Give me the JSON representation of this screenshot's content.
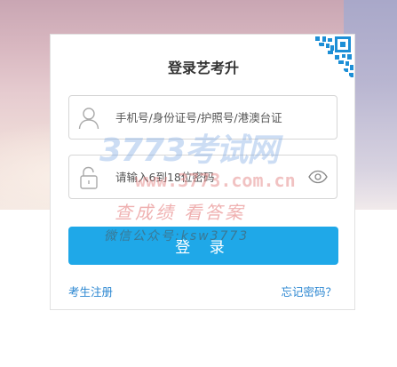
{
  "login": {
    "title": "登录艺考升",
    "account_placeholder": "手机号/身份证号/护照号/港澳台证",
    "password_placeholder": "请输入6到18位密码",
    "submit_label": "登 录",
    "register_link": "考生注册",
    "forgot_link": "忘记密码？"
  },
  "watermark": {
    "logo_text": "3773考试网",
    "url_text": "www.3773.com.cn",
    "slogan_text": "查成绩 看答案",
    "wechat_text": "微信公众号:ksw3773"
  },
  "icons": {
    "account": "user-icon",
    "password": "lock-icon",
    "toggle": "eye-icon",
    "qr": "qr-code-icon"
  },
  "colors": {
    "accent": "#1fa8e8",
    "link": "#2a86d1",
    "title": "#333333",
    "qr": "#1d8fd6"
  }
}
